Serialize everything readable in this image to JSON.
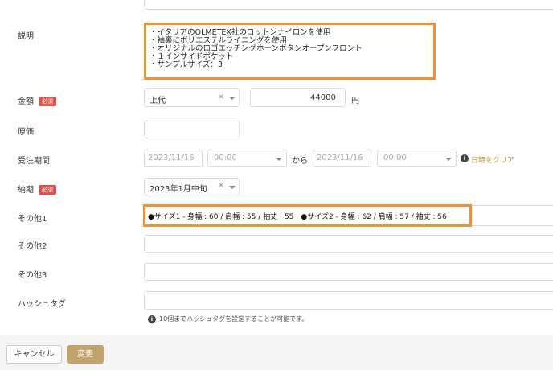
{
  "labels": {
    "description": "説明",
    "price": "金額",
    "required": "必須",
    "cost": "原価",
    "order_period": "受注期間",
    "delivery": "納期",
    "other1": "その他1",
    "other2": "その他2",
    "other3": "その他3",
    "hashtag": "ハッシュタグ"
  },
  "description_lines": [
    "・イタリアのOLMETEX社のコットンナイロンを使用",
    "・袖裏にポリエステルライニングを使用",
    "・オリジナルのロゴエッチングホーンボタンオープンフロント",
    "・１インサイドポケット",
    "・サンプルサイズ：3"
  ],
  "price": {
    "select_value": "上代",
    "amount": "44000",
    "unit": "円"
  },
  "order_period": {
    "start_date_placeholder": "2023/11/16",
    "start_time": "00:00",
    "separator": "から",
    "end_date_placeholder": "2023/11/16",
    "end_time": "00:00",
    "clear_link": "日時をクリア"
  },
  "delivery": {
    "select_value": "2023年1月中旬"
  },
  "other1_value": "●サイズ1 - 身幅 : 60 / 肩幅 : 55 / 袖丈 : 55　●サイズ2 - 身幅 : 62 / 肩幅 : 57 / 袖丈 : 56",
  "hashtag_help": "10個までハッシュタグを設定することが可能です。",
  "buttons": {
    "cancel": "キャンセル",
    "submit": "変更"
  },
  "colors": {
    "highlight": "#f0922e",
    "required_badge": "#d9534f",
    "submit_button": "#c2a36b",
    "clear_link": "#b8963e"
  },
  "icons": {
    "clear": "×",
    "caret": "chevron-down",
    "info": "i"
  }
}
